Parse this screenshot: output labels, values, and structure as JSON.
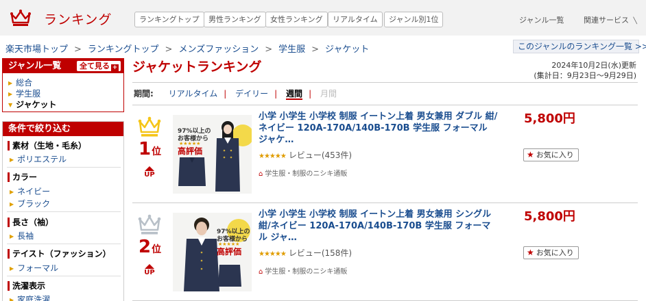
{
  "header": {
    "logo_text": "ランキング",
    "tabs": [
      "ランキングトップ",
      "男性ランキング",
      "女性ランキング",
      "リアルタイム",
      "ジャンル別1位"
    ],
    "links": [
      "ジャンル一覧",
      "関連サービス"
    ]
  },
  "breadcrumb": [
    "楽天市場トップ",
    "ランキングトップ",
    "メンズファッション",
    "学生服",
    "ジャケット"
  ],
  "breadcrumb_separator": ">",
  "genre_list_link": "このジャンルのランキング一覧 >>",
  "sidebar": {
    "genre": {
      "title": "ジャンル一覧",
      "show_all": "全て見る",
      "show_all_mark": "+",
      "items": [
        "総合",
        "学生服",
        "ジャケット"
      ]
    },
    "filter": {
      "title": "条件で絞り込む",
      "groups": [
        {
          "name": "素材（生地・毛糸）",
          "items": [
            "ポリエステル"
          ]
        },
        {
          "name": "カラー",
          "items": [
            "ネイビー",
            "ブラック"
          ]
        },
        {
          "name": "長さ（袖）",
          "items": [
            "長袖"
          ]
        },
        {
          "name": "テイスト（ファッション）",
          "items": [
            "フォーマル"
          ]
        },
        {
          "name": "洗濯表示",
          "items": [
            "家庭洗濯"
          ]
        }
      ]
    }
  },
  "main": {
    "title": "ジャケットランキング",
    "updated": "2024年10月2日(水)更新",
    "period_range": "(集計日：9月23日～9月29日)",
    "period": {
      "label": "期間:",
      "options": [
        "リアルタイム",
        "デイリー",
        "週間",
        "月間"
      ],
      "active": "週間",
      "disabled": "月間"
    }
  },
  "items": [
    {
      "rank": "1",
      "rank_suffix": "位",
      "crown_color": "#f5c518",
      "trend": "UP",
      "title": "小学 小学生 小学校 制服 イートン上着 男女兼用 ダブル 紺/ネイビー 120A-170A/140B-170B 学生服 フォーマル ジャケ…",
      "rating_value": 4.5,
      "review_text": "レビュー(453件)",
      "shop": "学生服・制服のニシキ通販",
      "price": "5,800円",
      "favorite_label": "お気に入り",
      "badge_text_1": "97%以上の",
      "badge_text_2": "お客様から",
      "badge_text_3": "高評価"
    },
    {
      "rank": "2",
      "rank_suffix": "位",
      "crown_color": "#b8c0c8",
      "trend": "UP",
      "title": "小学 小学生 小学校 制服 イートン上着 男女兼用 シングル 紺/ネイビー 120A-170A/140B-170B 学生服 フォーマル ジャ…",
      "rating_value": 4.5,
      "review_text": "レビュー(158件)",
      "shop": "学生服・制服のニシキ通販",
      "price": "5,800円",
      "favorite_label": "お気に入り",
      "badge_text_1": "97%以上の",
      "badge_text_2": "お客様から",
      "badge_text_3": "高評価"
    }
  ],
  "colors": {
    "brand": "#bf0000",
    "link": "#1a4d8f",
    "jacket": "#2b3550"
  }
}
